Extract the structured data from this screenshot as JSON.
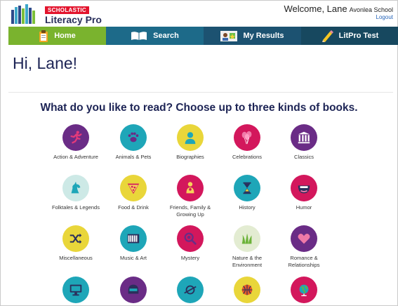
{
  "header": {
    "brand": "SCHOLASTIC",
    "product": "Literacy Pro",
    "welcome": "Welcome, Lane",
    "school": "Avonlea School",
    "logout": "Logout"
  },
  "nav": {
    "home": "Home",
    "search": "Search",
    "results": "My Results",
    "litpro": "LitPro Test"
  },
  "greeting": "Hi, Lane!",
  "prompt": "What do you like to read? Choose up to three kinds of books.",
  "genres": [
    {
      "label": "Action & Adventure",
      "color": "#6a2c86",
      "icon": "running-figure-icon"
    },
    {
      "label": "Animals & Pets",
      "color": "#1ea6b8",
      "icon": "paw-icon"
    },
    {
      "label": "Biographies",
      "color": "#e9d63a",
      "icon": "person-bust-icon"
    },
    {
      "label": "Celebrations",
      "color": "#d3175c",
      "icon": "balloons-icon"
    },
    {
      "label": "Classics",
      "color": "#6a2c86",
      "icon": "columns-icon"
    },
    {
      "label": "Folktales & Legends",
      "color": "#cde9e6",
      "icon": "unicorn-icon"
    },
    {
      "label": "Food & Drink",
      "color": "#e9d63a",
      "icon": "pizza-icon"
    },
    {
      "label": "Friends, Family & Growing Up",
      "color": "#d3175c",
      "icon": "family-icon"
    },
    {
      "label": "History",
      "color": "#1ea6b8",
      "icon": "hourglass-icon"
    },
    {
      "label": "Humor",
      "color": "#d3175c",
      "icon": "smile-icon"
    },
    {
      "label": "Miscellaneous",
      "color": "#e9d63a",
      "icon": "shuffle-icon"
    },
    {
      "label": "Music & Art",
      "color": "#1ea6b8",
      "icon": "keyboard-icon"
    },
    {
      "label": "Mystery",
      "color": "#d3175c",
      "icon": "magnifier-icon"
    },
    {
      "label": "Nature & the Environment",
      "color": "#e3ecd2",
      "icon": "grass-icon"
    },
    {
      "label": "Romance & Relationships",
      "color": "#6a2c86",
      "icon": "heart-icon"
    },
    {
      "label": "",
      "color": "#1ea6b8",
      "icon": "computer-icon"
    },
    {
      "label": "",
      "color": "#6a2c86",
      "icon": "helmet-icon"
    },
    {
      "label": "",
      "color": "#1ea6b8",
      "icon": "planet-icon"
    },
    {
      "label": "",
      "color": "#e9d63a",
      "icon": "basketball-icon"
    },
    {
      "label": "",
      "color": "#d3175c",
      "icon": "globe-icon"
    }
  ]
}
